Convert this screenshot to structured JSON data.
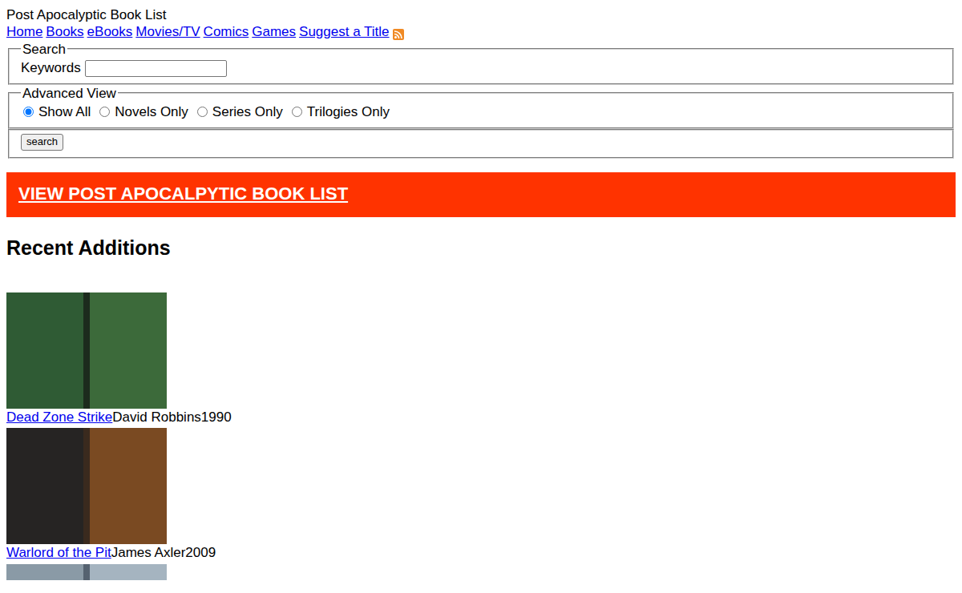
{
  "site_title": "Post Apocalyptic Book List",
  "nav": [
    "Home",
    "Books",
    "eBooks",
    "Movies/TV",
    "Comics",
    "Games",
    "Suggest a Title"
  ],
  "search": {
    "legend": "Search",
    "label": "Keywords",
    "value": ""
  },
  "advanced": {
    "legend": "Advanced View",
    "options": [
      {
        "label": "Show All",
        "selected": true
      },
      {
        "label": "Novels Only",
        "selected": false
      },
      {
        "label": "Series Only",
        "selected": false
      },
      {
        "label": "Trilogies Only",
        "selected": false
      }
    ]
  },
  "button": "search",
  "banner": "VIEW POST APOCALPYTIC BOOK LIST",
  "heading": "Recent Additions",
  "books": [
    {
      "title": "Dead Zone Strike",
      "author": "David Robbins",
      "year": "1990"
    },
    {
      "title": "Warlord of the Pit",
      "author": "James Axler",
      "year": "2009"
    }
  ]
}
